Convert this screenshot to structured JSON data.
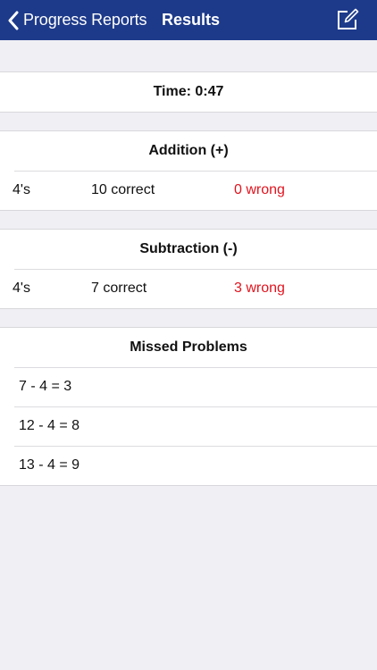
{
  "nav": {
    "back_label": "Progress Reports",
    "title": "Results"
  },
  "time": {
    "label": "Time: 0:47"
  },
  "addition": {
    "title": "Addition (+)",
    "rows": [
      {
        "fact": "4's",
        "correct": "10 correct",
        "wrong": "0 wrong"
      }
    ]
  },
  "subtraction": {
    "title": "Subtraction (-)",
    "rows": [
      {
        "fact": "4's",
        "correct": "7 correct",
        "wrong": "3 wrong"
      }
    ]
  },
  "missed": {
    "title": "Missed Problems",
    "items": [
      "7 - 4 = 3",
      "12 - 4 = 8",
      "13 - 4 = 9"
    ]
  },
  "colors": {
    "nav_background": "#1d3a8a",
    "wrong_text": "#e0141e",
    "page_background": "#efeff4"
  },
  "icons": {
    "back": "chevron-left-icon",
    "edit": "compose-icon"
  }
}
